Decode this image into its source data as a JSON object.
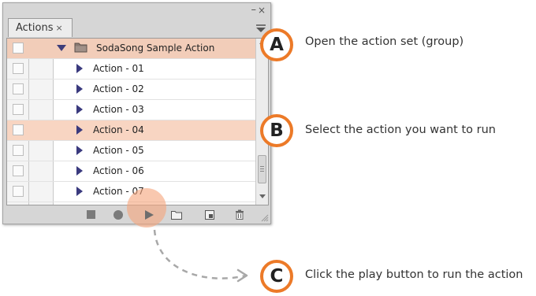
{
  "panel": {
    "tab_label": "Actions",
    "tab_close_glyph": "×",
    "minimize_glyph": "–",
    "close_glyph": "×",
    "action_set": {
      "name": "SodaSong Sample Action",
      "icon": "folder-icon",
      "expand_icon": "triangle-down-icon"
    },
    "actions": [
      {
        "label": "Action - 01",
        "selected": false
      },
      {
        "label": "Action - 02",
        "selected": false
      },
      {
        "label": "Action - 03",
        "selected": false
      },
      {
        "label": "Action - 04",
        "selected": true
      },
      {
        "label": "Action - 05",
        "selected": false
      },
      {
        "label": "Action - 06",
        "selected": false
      },
      {
        "label": "Action - 07",
        "selected": false
      }
    ],
    "bottom_buttons": [
      "stop-icon",
      "record-icon",
      "play-icon",
      "new-set-icon",
      "new-action-icon",
      "trash-icon"
    ]
  },
  "annotations": [
    {
      "letter": "A",
      "text": "Open the action set (group)"
    },
    {
      "letter": "B",
      "text": "Select the action you want to run"
    },
    {
      "letter": "C",
      "text": "Click the play button to run the action"
    }
  ],
  "colors": {
    "accent_orange": "#ec7a28",
    "set_row_highlight": "#f2cdb9",
    "selected_row_highlight": "#f8d5c2",
    "play_highlight": "#f6a67e",
    "triangle_blue": "#3a3a7e",
    "panel_gray": "#d6d6d6"
  }
}
